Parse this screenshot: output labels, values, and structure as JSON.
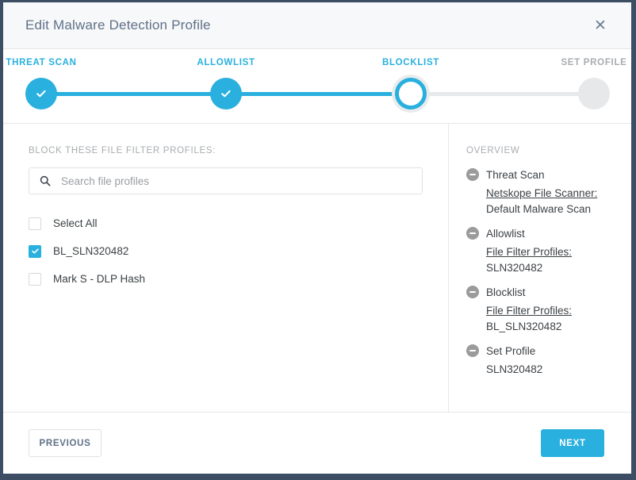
{
  "dialog": {
    "title": "Edit Malware Detection Profile",
    "close_icon": "close-icon",
    "close_glyph": "✕"
  },
  "colors": {
    "accent": "#29b0de",
    "track": "#e6e8e9",
    "title_text": "#5f7188",
    "muted_text": "#a9acaf",
    "body_text": "#3c4145",
    "page_background": "#3d4d63"
  },
  "stepper": {
    "steps": [
      {
        "label": "THREAT SCAN",
        "state": "done"
      },
      {
        "label": "ALLOWLIST",
        "state": "done"
      },
      {
        "label": "BLOCKLIST",
        "state": "current"
      },
      {
        "label": "SET PROFILE",
        "state": "inactive"
      }
    ],
    "progress_percent": 69
  },
  "left_panel": {
    "section_label": "BLOCK THESE FILE FILTER PROFILES:",
    "search": {
      "value": "",
      "placeholder": "Search file profiles",
      "icon": "search-icon"
    },
    "options": [
      {
        "label": "Select All",
        "checked": false
      },
      {
        "label": "BL_SLN320482",
        "checked": true
      },
      {
        "label": "Mark S - DLP Hash",
        "checked": false
      }
    ]
  },
  "overview": {
    "title": "OVERVIEW",
    "items": [
      {
        "heading": "Threat Scan",
        "key": "Netskope File Scanner:",
        "value": "Default Malware Scan"
      },
      {
        "heading": "Allowlist",
        "key": "File Filter Profiles:",
        "value": "SLN320482"
      },
      {
        "heading": "Blocklist",
        "key": "File Filter Profiles:",
        "value": "BL_SLN320482"
      },
      {
        "heading": "Set Profile",
        "key": "",
        "value": "SLN320482"
      }
    ]
  },
  "footer": {
    "previous_label": "PREVIOUS",
    "next_label": "NEXT"
  }
}
